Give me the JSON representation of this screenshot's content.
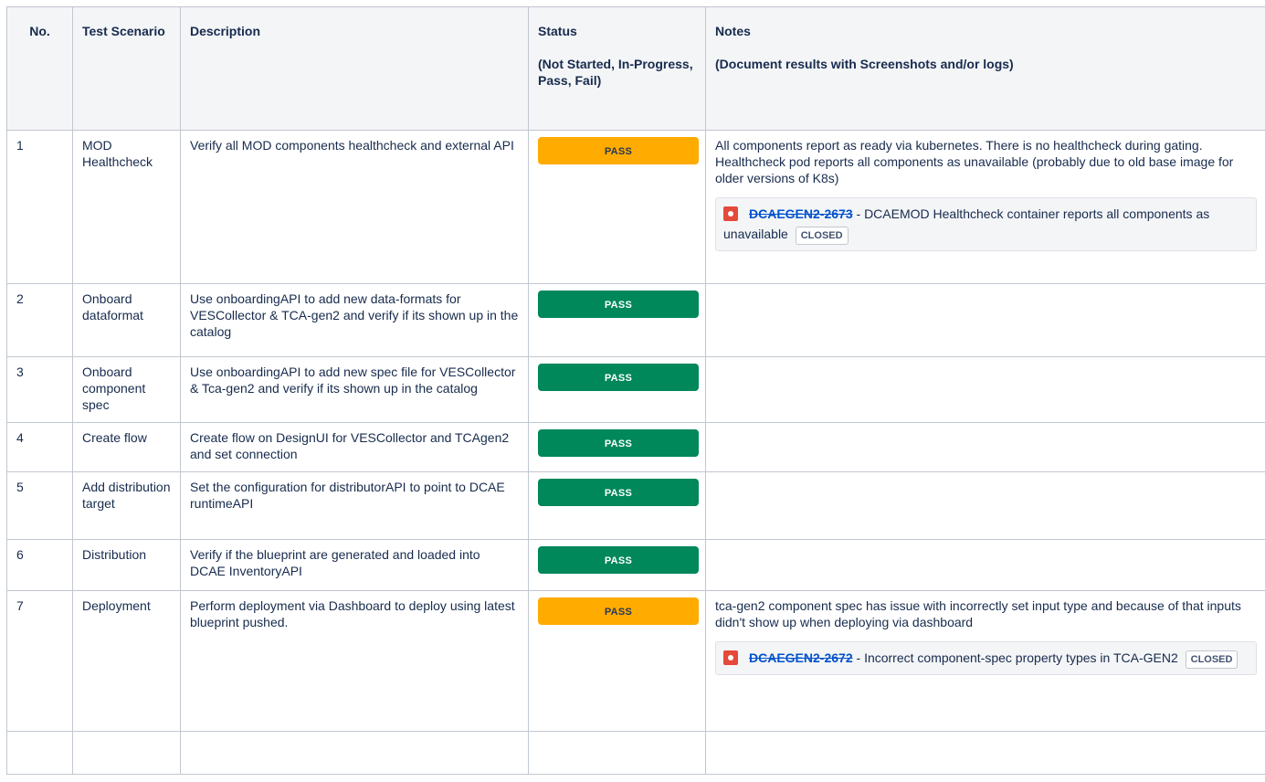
{
  "columns": {
    "no": "No.",
    "scenario": "Test Scenario",
    "description": "Description",
    "status_title": "Status",
    "status_sub": "(Not Started, In-Progress, Pass, Fail)",
    "notes_title": "Notes",
    "notes_sub": "(Document results with Screenshots and/or logs)"
  },
  "status_colors": {
    "pass_green": "#00875a",
    "pass_yellow": "#ffab00",
    "bug_icon": "#e5493a",
    "link": "#0052cc"
  },
  "rows": [
    {
      "no": "1",
      "scenario": "MOD Healthcheck",
      "description": "Verify all MOD components healthcheck and external API",
      "status": "PASS",
      "notes": "All components report as ready via kubernetes. There is no healthcheck during gating. Healthcheck pod reports all components as unavailable (probably due to old base image for older versions of K8s)",
      "issue": {
        "key": "DCAEGEN2-2673",
        "sep": " - ",
        "summary": "DCAEMOD Healthcheck container reports all components as unavailable",
        "state": "CLOSED"
      }
    },
    {
      "no": "2",
      "scenario": "Onboard dataformat",
      "description": "Use onboardingAPI to add new data-formats for VESCollector & TCA-gen2 and verify if its shown up in the catalog",
      "status": "PASS"
    },
    {
      "no": "3",
      "scenario": "Onboard component spec",
      "description": "Use onboardingAPI to add new spec file for VESCollector & Tca-gen2 and verify if its shown up in the catalog",
      "status": "PASS"
    },
    {
      "no": "4",
      "scenario": "Create flow",
      "description": "Create flow on DesignUI for VESCollector and TCAgen2 and set connection",
      "status": "PASS"
    },
    {
      "no": "5",
      "scenario": "Add distribution target",
      "description": "Set the configuration for distributorAPI to point to DCAE runtimeAPI",
      "status": "PASS"
    },
    {
      "no": "6",
      "scenario": "Distribution",
      "description": "Verify if the blueprint are generated and loaded into DCAE InventoryAPI",
      "status": "PASS"
    },
    {
      "no": "7",
      "scenario": "Deployment",
      "description": "Perform deployment via Dashboard to deploy using latest blueprint pushed.",
      "status": "PASS",
      "notes": "tca-gen2 component spec has issue with incorrectly set input type and because of that inputs didn't show up when deploying via dashboard",
      "issue": {
        "key": "DCAEGEN2-2672",
        "sep": " - ",
        "summary": "Incorrect component-spec property types in TCA-GEN2",
        "state": "CLOSED"
      }
    }
  ]
}
